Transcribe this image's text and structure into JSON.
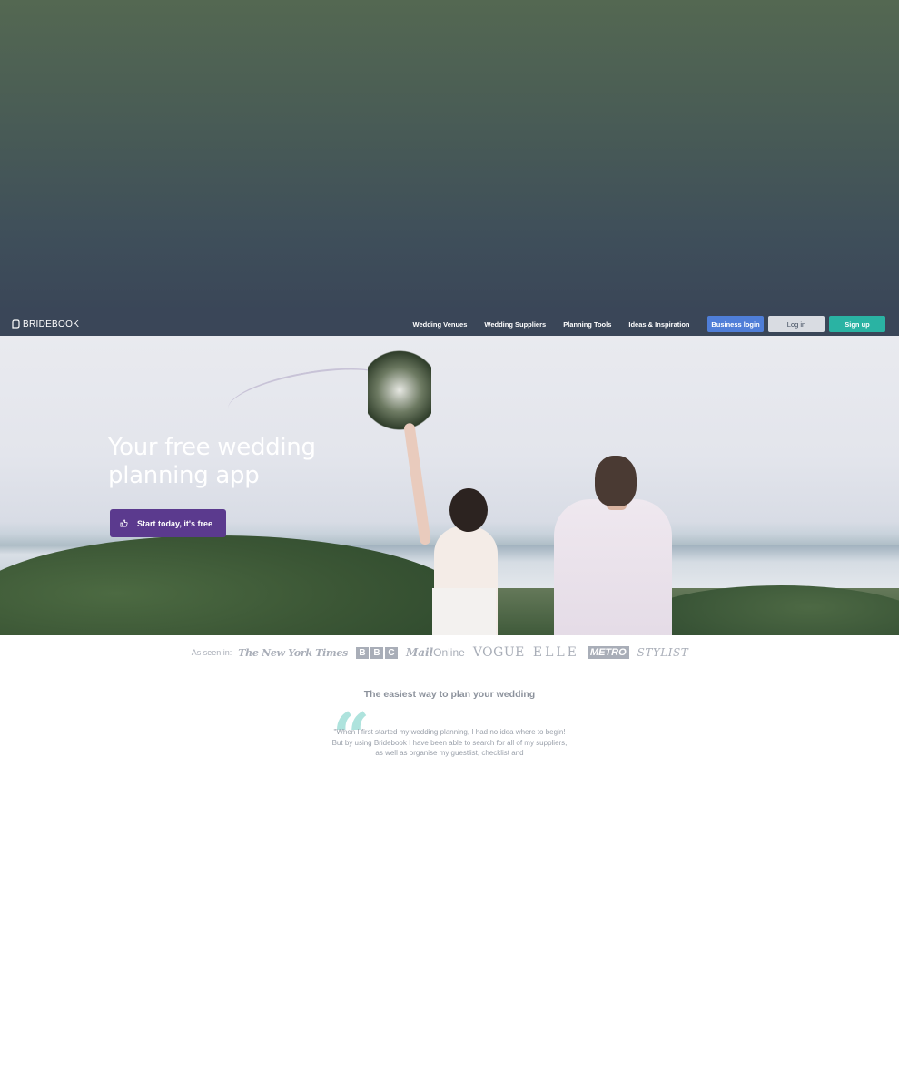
{
  "nav": {
    "logo_text": "BRIDEBOOK",
    "links": [
      "Wedding Venues",
      "Wedding Suppliers",
      "Planning Tools",
      "Ideas & Inspiration"
    ],
    "business_login": "Business login",
    "log_in": "Log in",
    "sign_up": "Sign up"
  },
  "hero": {
    "title_line1": "Your free wedding",
    "title_line2": "planning app",
    "cta_label": "Start today, it's free"
  },
  "press": {
    "label": "As seen in:",
    "nyt": "The New York Times",
    "bbc": [
      "B",
      "B",
      "C"
    ],
    "mail_bold": "Mail",
    "mail_rest": "Online",
    "vogue": "VOGUE",
    "elle": "ELLE",
    "metro": "METRO",
    "stylist": "STYLIST"
  },
  "testimonial": {
    "section_title": "The easiest way to plan your wedding",
    "quote": "\"When I first started my wedding planning, I had no idea where to begin! But by using Bridebook I have been able to search for all of my suppliers, as well as organise my guestlist, checklist and"
  },
  "colors": {
    "navbar": "#3a4658",
    "business_login": "#4f7ed8",
    "sign_up": "#2ab3a3",
    "cta": "#5b3a8e",
    "quote_mark": "#aee3dd"
  }
}
